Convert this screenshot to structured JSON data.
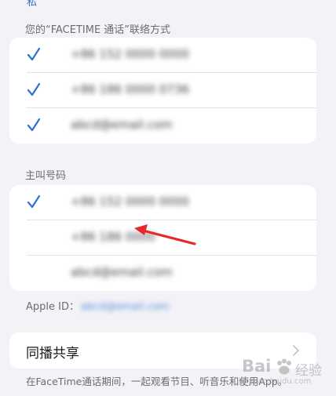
{
  "facetime_contacts": {
    "header": "您的“FACETIME 通话”联络方式",
    "items": [
      {
        "value": "+86 152 0000 0000",
        "checked": true
      },
      {
        "value": "+86 186 0000 0736",
        "checked": true
      },
      {
        "value": "abcd@email.com",
        "checked": true
      }
    ]
  },
  "caller_id": {
    "header": "主叫号码",
    "items": [
      {
        "value": "+86 152 0000 0000",
        "checked": true
      },
      {
        "value": "+86 186 0000",
        "checked": false
      },
      {
        "value": "abcd@email.com",
        "checked": false
      }
    ]
  },
  "apple_id": {
    "label": "Apple ID：",
    "value": "abcd@email.com"
  },
  "shareplay": {
    "label": "同播共享"
  },
  "footer": {
    "text": "在FaceTime通话期间，一起观看节目、听音乐和使用App。"
  },
  "watermark": {
    "brand": "Bai",
    "suffix": "经验",
    "url": "jingyan.baidu.com"
  },
  "colors": {
    "accent": "#2f6fd6",
    "annotation_arrow": "#e8262a",
    "background": "#f2f2f7"
  }
}
